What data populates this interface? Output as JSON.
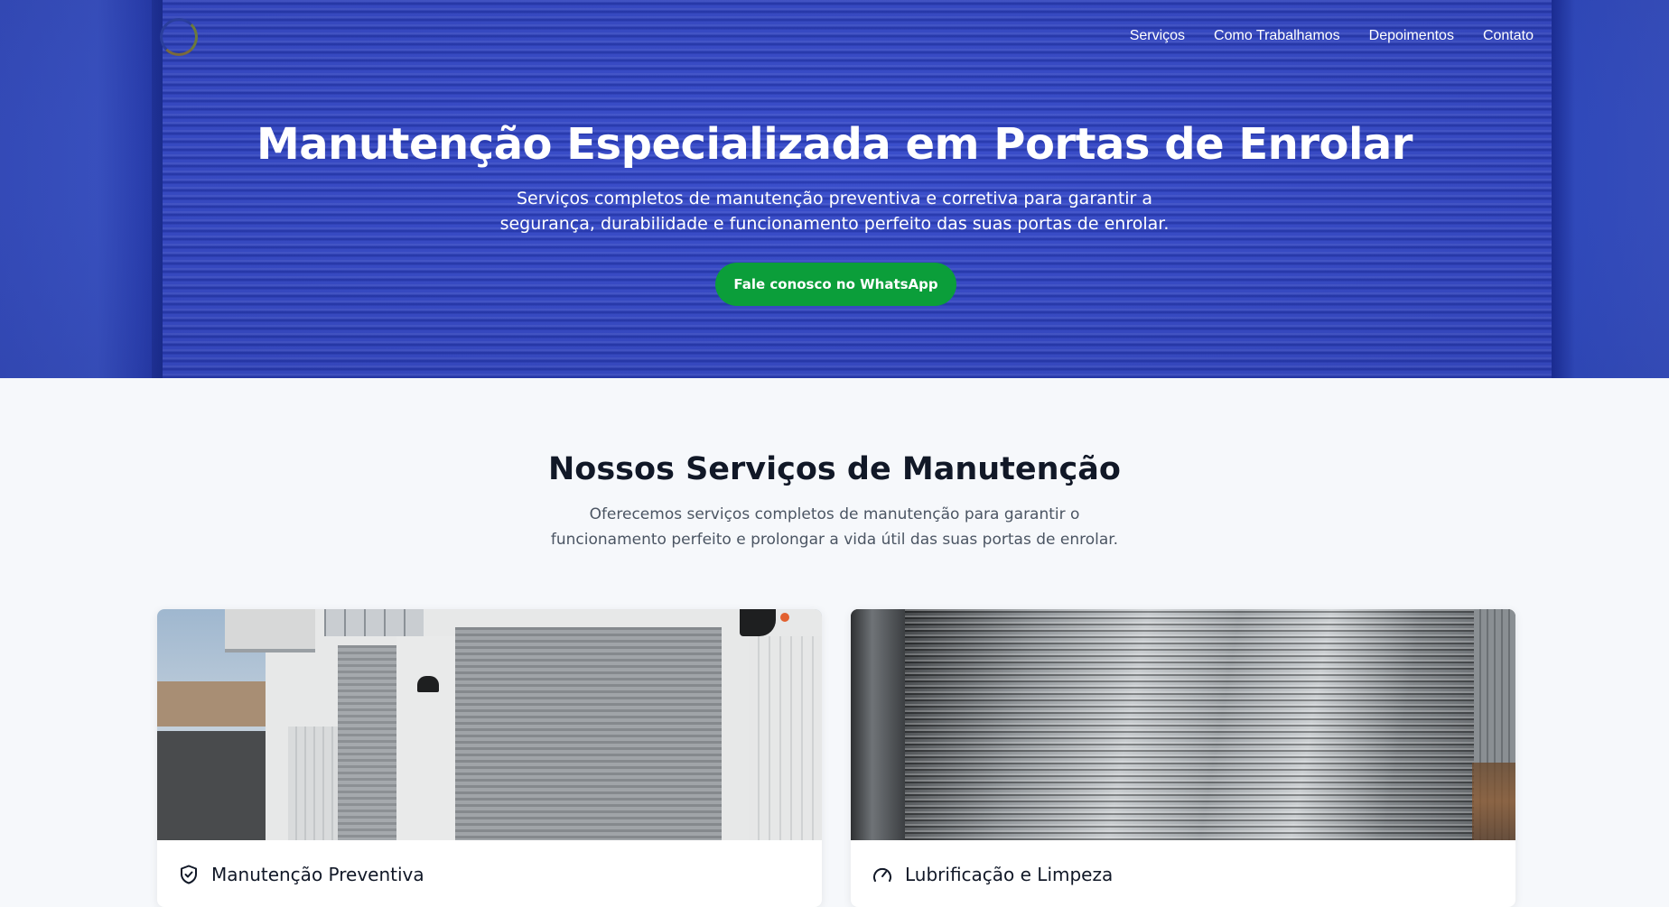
{
  "nav": {
    "items": [
      {
        "label": "Serviços"
      },
      {
        "label": "Como Trabalhamos"
      },
      {
        "label": "Depoimentos"
      },
      {
        "label": "Contato"
      }
    ]
  },
  "hero": {
    "title": "Manutenção Especializada em Portas de Enrolar",
    "subtitle": "Serviços completos de manutenção preventiva e corretiva para garantir a segurança, durabilidade e funcionamento perfeito das suas portas de enrolar.",
    "cta_label": "Fale conosco no WhatsApp"
  },
  "services": {
    "title": "Nossos Serviços de Manutenção",
    "subtitle": "Oferecemos serviços completos de manutenção para garantir o funcionamento perfeito e prolongar a vida útil das suas portas de enrolar.",
    "cards": [
      {
        "icon": "shield-check-icon",
        "title": "Manutenção Preventiva"
      },
      {
        "icon": "gauge-icon",
        "title": "Lubrificação e Limpeza"
      }
    ]
  },
  "colors": {
    "hero_blue": "#3448c9",
    "cta_green": "#0b9e3a",
    "page_bg": "#f6f8fb",
    "heading": "#111827",
    "muted_text": "#4b5563"
  }
}
